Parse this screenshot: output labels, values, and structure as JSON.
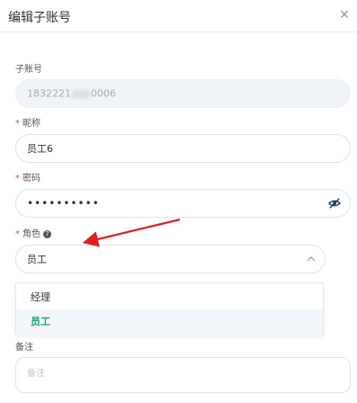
{
  "dialog": {
    "title": "编辑子账号",
    "close_icon": "close-icon"
  },
  "form": {
    "account": {
      "label": "子账号",
      "value_prefix": "1832221",
      "value_suffix": "0006"
    },
    "nickname": {
      "label": "昵称",
      "value": "员工6"
    },
    "password": {
      "label": "密码",
      "value": "••••••••••",
      "toggle_icon": "eye-off-icon"
    },
    "role": {
      "label": "角色",
      "help_glyph": "?",
      "selected": "员工",
      "options": [
        "经理",
        "员工"
      ]
    },
    "remark": {
      "label": "备注",
      "placeholder": "备注"
    }
  },
  "colors": {
    "required": "#e74c3c",
    "accent": "#16a574",
    "arrow": "#e02020"
  }
}
